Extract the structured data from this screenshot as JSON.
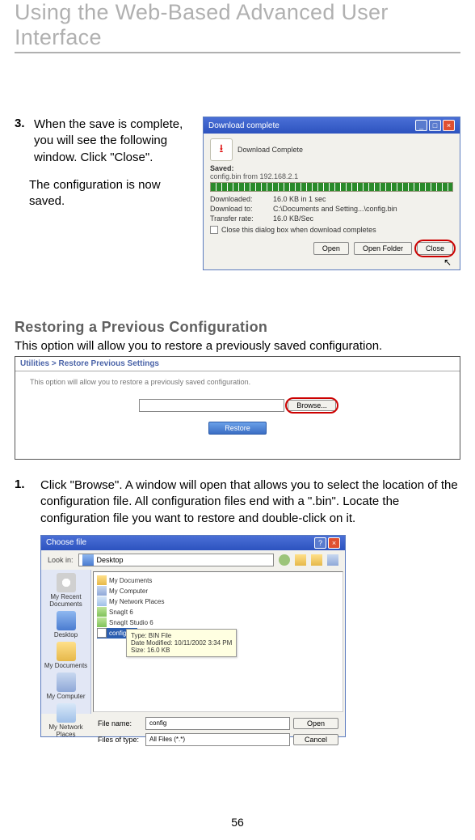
{
  "page_title": "Using the Web-Based Advanced User Interface",
  "page_number": "56",
  "step3": {
    "num": "3.",
    "text": "When the save is complete, you will see the following window. Click \"Close\".",
    "text2": "The configuration is now saved."
  },
  "download_complete": {
    "title": "Download complete",
    "header_label": "Download Complete",
    "saved_label": "Saved:",
    "saved_value": "config.bin from 192.168.2.1",
    "downloaded_label": "Downloaded:",
    "downloaded_value": "16.0 KB in 1 sec",
    "download_to_label": "Download to:",
    "download_to_value": "C:\\Documents and Setting...\\config.bin",
    "transfer_rate_label": "Transfer rate:",
    "transfer_rate_value": "16.0 KB/Sec",
    "checkbox_label": "Close this dialog box when download completes",
    "buttons": {
      "open": "Open",
      "open_folder": "Open Folder",
      "close": "Close"
    }
  },
  "restore": {
    "heading": "Restoring a Previous Configuration",
    "desc": "This option will allow you to restore a previously saved configuration.",
    "panel_title": "Utilities > Restore Previous Settings",
    "panel_text": "This option will allow you to restore a previously saved configuration.",
    "browse_label": "Browse...",
    "restore_label": "Restore"
  },
  "step1": {
    "num": "1.",
    "text": "Click \"Browse\". A window will open that allows you to select the location of the configuration file. All configuration files end with a \".bin\". Locate the configuration file you want to restore and double-click on it."
  },
  "choose_file": {
    "title": "Choose file",
    "lookin_label": "Look in:",
    "lookin_value": "Desktop",
    "sidebar": [
      "My Recent Documents",
      "Desktop",
      "My Documents",
      "My Computer",
      "My Network Places"
    ],
    "files": [
      "My Documents",
      "My Computer",
      "My Network Places",
      "SnagIt 6",
      "SnagIt Studio 6",
      "config"
    ],
    "tooltip": {
      "l1": "Type: BIN File",
      "l2": "Date Modified: 10/11/2002 3:34 PM",
      "l3": "Size: 16.0 KB"
    },
    "filename_label": "File name:",
    "filename_value": "config",
    "filetype_label": "Files of type:",
    "filetype_value": "All Files (*.*)",
    "open_label": "Open",
    "cancel_label": "Cancel"
  }
}
